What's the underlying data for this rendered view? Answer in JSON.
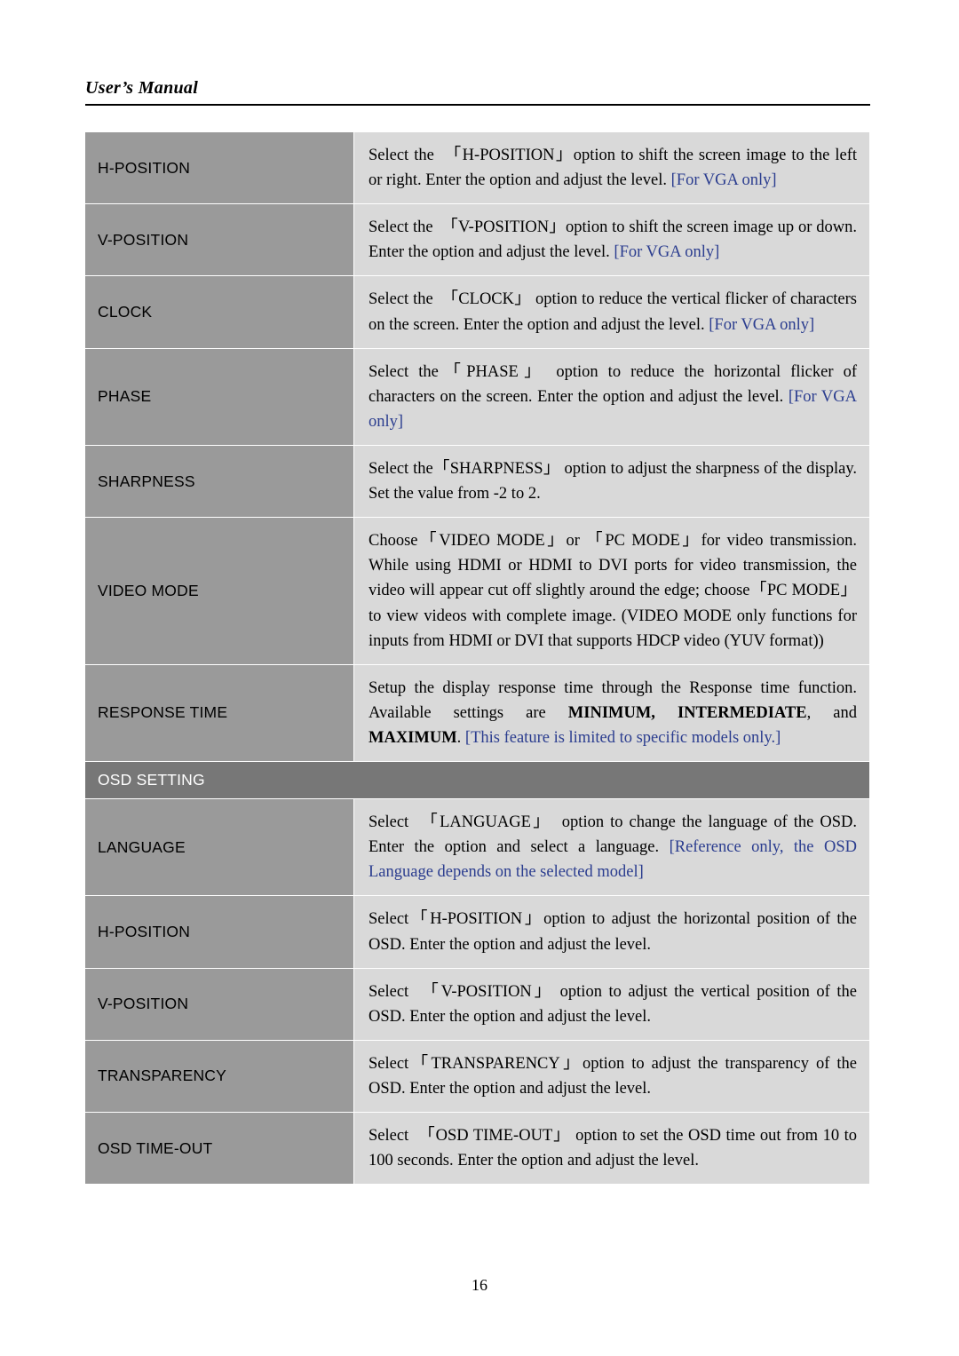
{
  "header": {
    "title": "User’s Manual"
  },
  "footer": {
    "page_number": "16"
  },
  "rows": [
    {
      "label": "H-POSITION",
      "desc_html": "Select the　「H-POSITION」option to shift the screen image to the left or right. Enter the option and adjust the level. <span class=\"blue\">[For VGA only]</span>"
    },
    {
      "label": "V-POSITION",
      "desc_html": "Select the　「V-POSITION」option to shift the screen image up or down. Enter the option and adjust the level. <span class=\"blue\">[For VGA only]</span>"
    },
    {
      "label": "CLOCK",
      "desc_html": "Select the　「CLOCK」 option to reduce the vertical flicker of characters on the screen. Enter the option and adjust the level. <span class=\"blue\">[For VGA only]</span>"
    },
    {
      "label": "PHASE",
      "desc_html": "Select the「PHASE」 option to reduce the horizontal flicker of characters on the screen. Enter the option and adjust the level. <span class=\"blue\">[For VGA only]</span>"
    },
    {
      "label": "SHARPNESS",
      "desc_html": "Select the「SHARPNESS」 option to adjust the sharpness of the display. Set the value from -2 to 2."
    },
    {
      "label": "VIDEO MODE",
      "desc_html": "Choose「VIDEO MODE」or 「PC MODE」for video transmission. While using HDMI or HDMI to DVI ports for video transmission, the video will appear cut off slightly around the edge; choose「PC MODE」to view videos with complete image. (VIDEO MODE only functions for inputs from HDMI or DVI that supports HDCP video (YUV format))"
    },
    {
      "label": "RESPONSE TIME",
      "desc_html": "Setup the display response time through the Response time function. Available settings are <span class=\"bold\">MINIMUM, INTERMEDIATE</span>, and <span class=\"bold\">MAXIMUM</span>. <span class=\"blue\">[This feature is limited to specific models only.]</span>"
    },
    {
      "section": "OSD SETTING"
    },
    {
      "label": "LANGUAGE",
      "desc_html": "Select　「LANGUAGE」　option to change the language of the OSD. Enter the option and select a language. <span class=\"blue\">[Reference only, the OSD Language depends on the selected model]</span>"
    },
    {
      "label": "H-POSITION",
      "desc_html": "Select「H-POSITION」option to adjust the horizontal position of the OSD. Enter the option and adjust the level."
    },
    {
      "label": "V-POSITION",
      "desc_html": "Select　「V-POSITION」 option to adjust the vertical position of the OSD. Enter the option and adjust the level."
    },
    {
      "label": "TRANSPARENCY",
      "desc_html": "Select「TRANSPARENCY」option to adjust the transparency of the OSD. Enter the option and adjust the level."
    },
    {
      "label": "OSD TIME-OUT",
      "desc_html": "Select　「OSD TIME-OUT」 option to set the OSD time out from 10 to 100 seconds. Enter the option and adjust the level."
    }
  ]
}
